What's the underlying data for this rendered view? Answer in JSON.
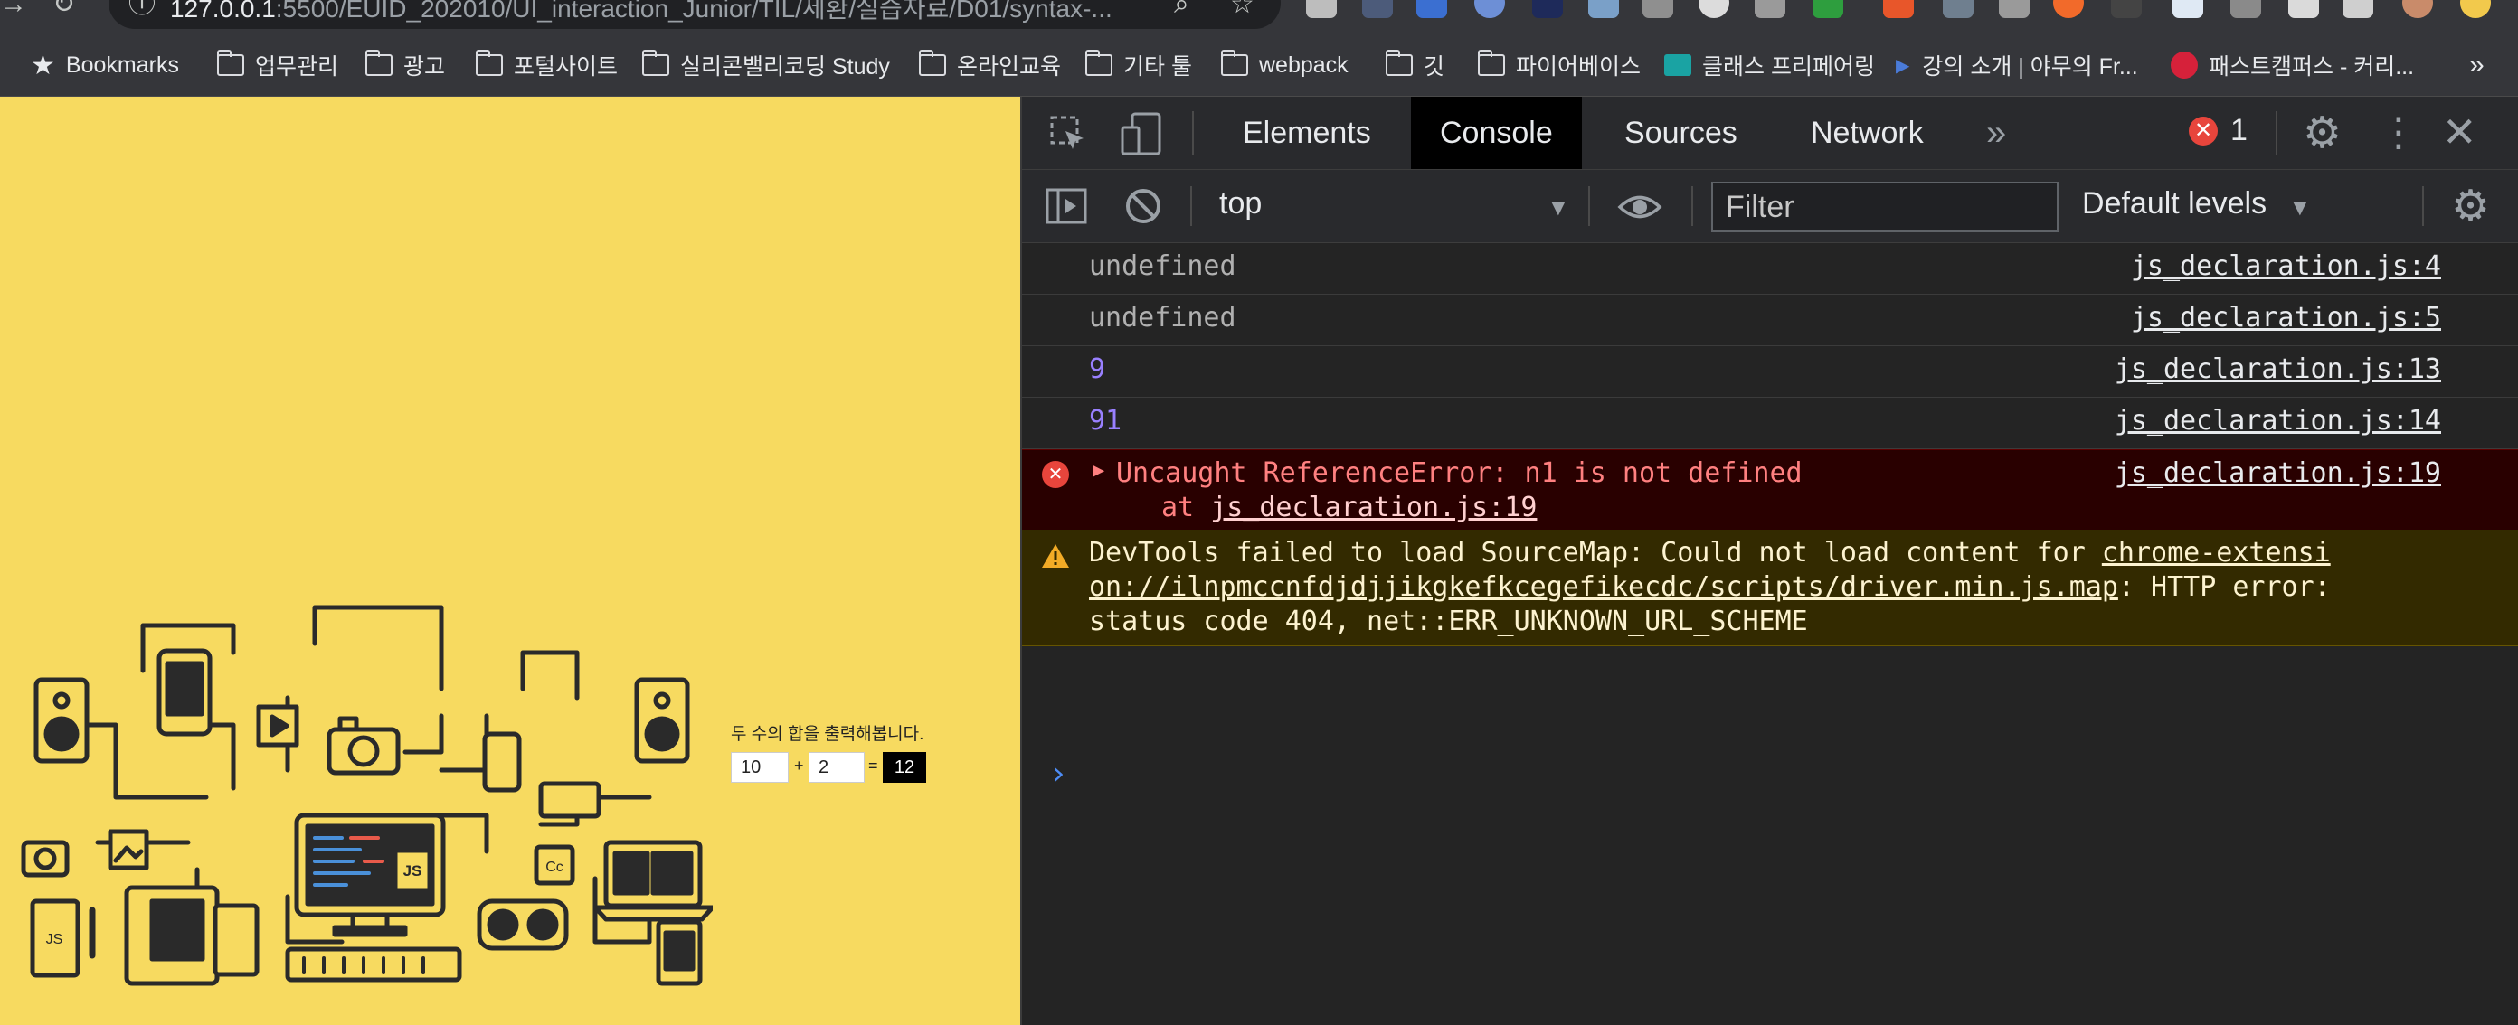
{
  "browser": {
    "url_host": "127.0.0.1",
    "url_rest": ":5500/EUID_202010/UI_interaction_Junior/TIL/세환/실습자료/D01/syntax-...",
    "bookmarks": [
      {
        "label": "Bookmarks",
        "icon": "star-icon"
      },
      {
        "label": "업무관리",
        "icon": "folder-icon"
      },
      {
        "label": "광고",
        "icon": "folder-icon"
      },
      {
        "label": "포털사이트",
        "icon": "folder-icon"
      },
      {
        "label": "실리콘밸리코딩 Study",
        "icon": "folder-icon"
      },
      {
        "label": "온라인교육",
        "icon": "folder-icon"
      },
      {
        "label": "기타 툴",
        "icon": "folder-icon"
      },
      {
        "label": "webpack",
        "icon": "folder-icon"
      },
      {
        "label": "깃",
        "icon": "folder-icon"
      },
      {
        "label": "파이어베이스",
        "icon": "folder-icon"
      },
      {
        "label": "클래스 프리페어링",
        "icon": "class-icon"
      },
      {
        "label": "강의 소개 | 야무의 Fr...",
        "icon": "play-icon"
      },
      {
        "label": "패스트캠퍼스 - 커리...",
        "icon": "fastcampus-icon"
      }
    ]
  },
  "page": {
    "label": "두 수의 합을 출력해봅니다.",
    "input1": "10",
    "input2": "2",
    "plus": "+",
    "equals": "=",
    "result": "12"
  },
  "devtools": {
    "tabs": [
      "Elements",
      "Console",
      "Sources",
      "Network"
    ],
    "active_tab": "Console",
    "error_count": "1",
    "context": "top",
    "filter_placeholder": "Filter",
    "levels": "Default levels",
    "logs": [
      {
        "msg": "undefined",
        "src": "js_declaration.js:4"
      },
      {
        "msg": "undefined",
        "src": "js_declaration.js:5"
      },
      {
        "msg": "9",
        "src": "js_declaration.js:13"
      },
      {
        "msg": "91",
        "src": "js_declaration.js:14"
      }
    ],
    "error": {
      "msg": "Uncaught ReferenceError: n1 is not defined",
      "at": "at ",
      "at_link": "js_declaration.js:19",
      "src": "js_declaration.js:19"
    },
    "warning": {
      "line1_text": "DevTools failed to load SourceMap: Could not load content for ",
      "line1_link": "chrome-extensi",
      "line2_link": "on://ilnpmccnfdjdjjikgkefkcegefikecdc/scripts/driver.min.js.map",
      "line2_text": ": HTTP error:",
      "line3_text": "status code 404, net::ERR_UNKNOWN_URL_SCHEME"
    },
    "colors": {
      "accent_error": "#e8453c",
      "number": "#9980ff",
      "warning_bg": "#332a00",
      "error_bg": "#290000"
    }
  }
}
